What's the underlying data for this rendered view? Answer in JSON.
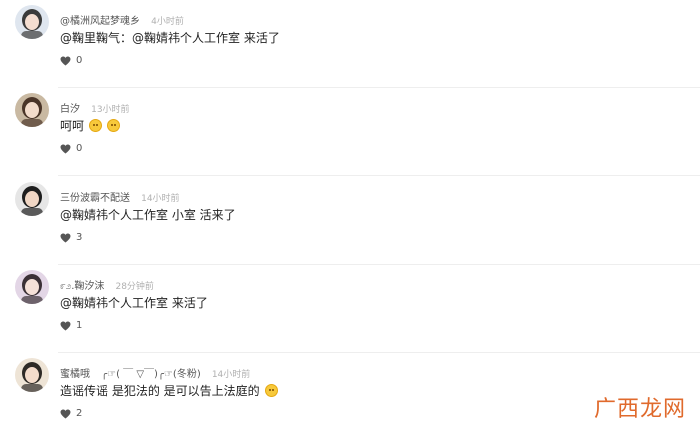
{
  "comments": [
    {
      "username": "@橘洲风起梦魂乡",
      "time": "4小时前",
      "text": "@鞠里鞠气：@鞠婧祎个人工作室 来活了",
      "emoji_count": 0,
      "likes": "0",
      "avatar_colors": {
        "bg": "#dfe6ef",
        "hair": "#3a3a3a",
        "face": "#f4ddd0"
      }
    },
    {
      "username": "白汐",
      "time": "13小时前",
      "text": "呵呵",
      "emoji_count": 2,
      "likes": "0",
      "avatar_colors": {
        "bg": "#c9b9a2",
        "hair": "#4a3528",
        "face": "#f3dccb"
      }
    },
    {
      "username": "三份波霸不配送",
      "time": "14小时前",
      "text": "@鞠婧祎个人工作室 小室 活来了",
      "emoji_count": 0,
      "likes": "3",
      "avatar_colors": {
        "bg": "#e6e6e6",
        "hair": "#1e1e1e",
        "face": "#f0d6c4"
      }
    },
    {
      "username": "೯೨.鞠汐沫",
      "time": "28分钟前",
      "text": "@鞠婧祎个人工作室 来活了",
      "emoji_count": 0,
      "likes": "1",
      "avatar_colors": {
        "bg": "#e3d6e6",
        "hair": "#3b3036",
        "face": "#f5e0d8"
      }
    },
    {
      "username": "蜜橘哦",
      "badges": "╭☞( ￣ ▽￣)╭☞(冬粉)",
      "time": "14小时前",
      "text": "造谣传谣 是犯法的 是可以告上法庭的",
      "emoji_count": 1,
      "likes": "2",
      "avatar_colors": {
        "bg": "#eee4d6",
        "hair": "#2e2a26",
        "face": "#f4dccb"
      }
    }
  ],
  "watermark": "广西龙网",
  "colors": {
    "accent_watermark": "#e06a2c",
    "heart": "#555555"
  },
  "icons": {
    "like": "heart-icon"
  }
}
